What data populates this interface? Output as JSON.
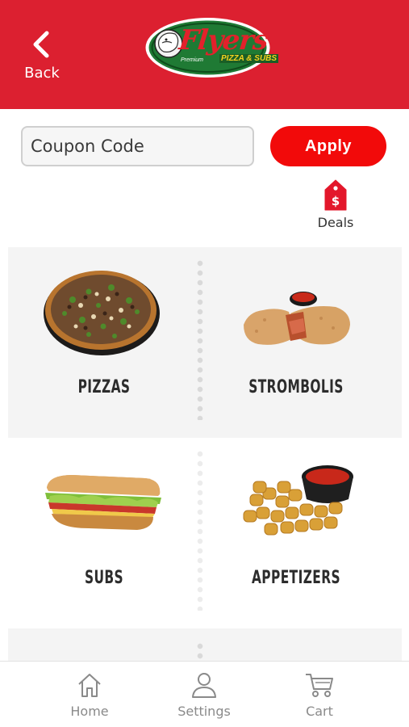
{
  "header": {
    "back_label": "Back",
    "logo": {
      "brand": "Flyers",
      "tagline": "PIZZA & SUBS",
      "premium": "Premium"
    },
    "background_color": "#dc2030"
  },
  "coupon": {
    "placeholder": "Coupon Code",
    "value": "",
    "apply_label": "Apply",
    "apply_color": "#f20a0a"
  },
  "deals": {
    "label": "Deals",
    "icon": "price-tag-dollar-icon"
  },
  "categories": [
    {
      "label": "PIZZAS",
      "image": "pizza-image"
    },
    {
      "label": "STROMBOLIS",
      "image": "stromboli-image"
    },
    {
      "label": "SUBS",
      "image": "sub-sandwich-image"
    },
    {
      "label": "APPETIZERS",
      "image": "cheese-bites-image"
    }
  ],
  "tabbar": {
    "items": [
      {
        "label": "Home",
        "icon": "home-icon"
      },
      {
        "label": "Settings",
        "icon": "person-icon"
      },
      {
        "label": "Cart",
        "icon": "cart-icon"
      }
    ]
  }
}
